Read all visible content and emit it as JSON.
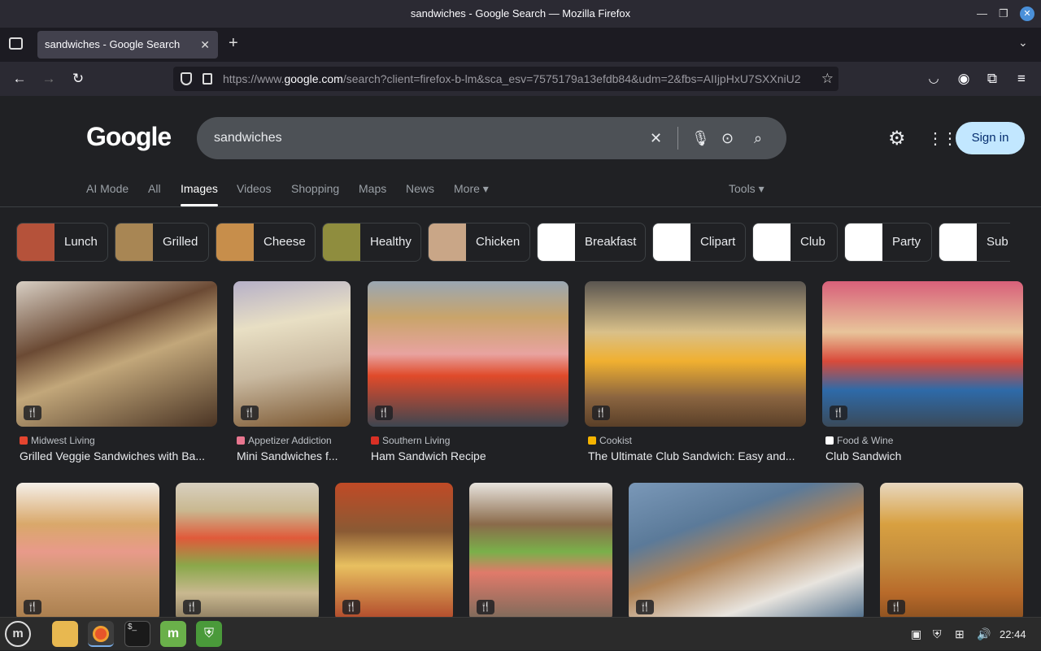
{
  "window": {
    "title": "sandwiches - Google Search — Mozilla Firefox"
  },
  "tab": {
    "label": "sandwiches - Google Search"
  },
  "address": {
    "host_prefix": "https://www.",
    "host": "google.com",
    "path": "/search?client=firefox-b-lm&sca_esv=7575179a13efdb84&udm=2&fbs=AIIjpHxU7SXXniU2"
  },
  "google": {
    "logo": "Google",
    "query": "sandwiches",
    "sign_in": "Sign in",
    "nav": [
      "AI Mode",
      "All",
      "Images",
      "Videos",
      "Shopping",
      "Maps",
      "News",
      "More ▾"
    ],
    "tools": "Tools ▾"
  },
  "chips": [
    {
      "label": "Lunch",
      "color": "#b5523a"
    },
    {
      "label": "Grilled",
      "color": "#a88654"
    },
    {
      "label": "Cheese",
      "color": "#c78e4b"
    },
    {
      "label": "Healthy",
      "color": "#8f8d3e"
    },
    {
      "label": "Chicken",
      "color": "#c9a687"
    },
    {
      "label": "Breakfast",
      "color": "#ffffff"
    },
    {
      "label": "Clipart",
      "color": "#ffffff"
    },
    {
      "label": "Club",
      "color": "#ffffff"
    },
    {
      "label": "Party",
      "color": "#ffffff"
    },
    {
      "label": "Sub",
      "color": "#ffffff"
    }
  ],
  "results_row1": [
    {
      "source": "Midwest Living",
      "title": "Grilled Veggie Sandwiches with Ba...",
      "fav": "#e4452f",
      "bg": "#6b4a34"
    },
    {
      "source": "Appetizer Addiction",
      "title": "Mini Sandwiches f...",
      "fav": "#e8768f",
      "bg": "#c9b9a0"
    },
    {
      "source": "Southern Living",
      "title": "Ham Sandwich Recipe",
      "fav": "#d93025",
      "bg": "#5c6a78"
    },
    {
      "source": "Cookist",
      "title": "The Ultimate Club Sandwich: Easy and...",
      "fav": "#f5b400",
      "bg": "#7a5d45"
    },
    {
      "source": "Food & Wine",
      "title": "Club Sandwich",
      "fav": "#ffffff",
      "bg": "#c8587a"
    }
  ],
  "results_row2": [
    {
      "bg": "#c99a6c"
    },
    {
      "bg": "#8a7a5e"
    },
    {
      "bg": "#b0462a"
    },
    {
      "bg": "#7a6a5a"
    },
    {
      "bg": "#5b7a99"
    },
    {
      "bg": "#c48d3e"
    }
  ],
  "taskbar": {
    "clock": "22:44"
  }
}
